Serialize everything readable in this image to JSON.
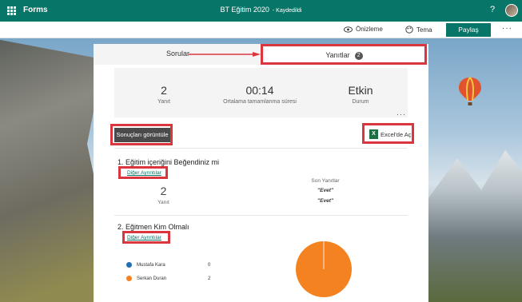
{
  "topbar": {
    "app_name": "Forms",
    "title": "BT Eğitim 2020",
    "save_status": "- Kaydedildi",
    "help_label": "?",
    "bg_color": "#077568"
  },
  "toolbar": {
    "preview_label": "Önizleme",
    "theme_label": "Tema",
    "share_label": "Paylaş",
    "more_label": "···"
  },
  "tabs": {
    "questions_label": "Sorular",
    "responses_label": "Yanıtlar",
    "responses_count": "2"
  },
  "summary": {
    "responses_value": "2",
    "responses_label": "Yanıt",
    "avg_time_value": "00:14",
    "avg_time_label": "Ortalama tamamlanma süresi",
    "status_value": "Etkin",
    "status_label": "Durum",
    "more_label": "···"
  },
  "actions": {
    "view_results_label": "Sonuçları görüntüle",
    "open_excel_label": "Excel'de Aç"
  },
  "questions": [
    {
      "title": "1.  Eğitim içeriğini Beğendiniz mi",
      "details_link": "Diğer Ayrıntılar",
      "count_value": "2",
      "count_label": "Yanıt",
      "recent_header": "Son Yanıtlar",
      "recent_answers": [
        "\"Evet\"",
        "\"Evet\""
      ]
    },
    {
      "title": "2.  Eğitmen Kim Olmalı",
      "details_link": "Diğer Ayrıntılar",
      "options": [
        {
          "label": "Mustafa Kara",
          "count": "0",
          "color": "#1f6fb5"
        },
        {
          "label": "Serkan Duran",
          "count": "2",
          "color": "#f58220"
        }
      ]
    }
  ],
  "highlight_color": "#d9363e"
}
